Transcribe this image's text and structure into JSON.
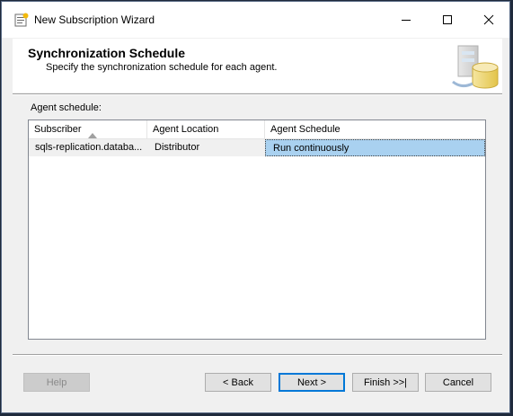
{
  "window": {
    "title": "New Subscription Wizard"
  },
  "header": {
    "title": "Synchronization Schedule",
    "subtitle": "Specify the synchronization schedule for each agent."
  },
  "agent_schedule": {
    "label": "Agent schedule:",
    "columns": [
      "Subscriber",
      "Agent Location",
      "Agent Schedule"
    ],
    "sort_column": "Subscriber",
    "rows": [
      {
        "subscriber": "sqls-replication.databa...",
        "agent_location": "Distributor",
        "agent_schedule": "Run continuously"
      }
    ]
  },
  "buttons": {
    "help": "Help",
    "back": "< Back",
    "next": "Next >",
    "finish": "Finish >>|",
    "cancel": "Cancel"
  },
  "colors": {
    "selection": "#a9d1f0",
    "focus_border": "#0078d7",
    "desktop": "#1f2a3c"
  }
}
